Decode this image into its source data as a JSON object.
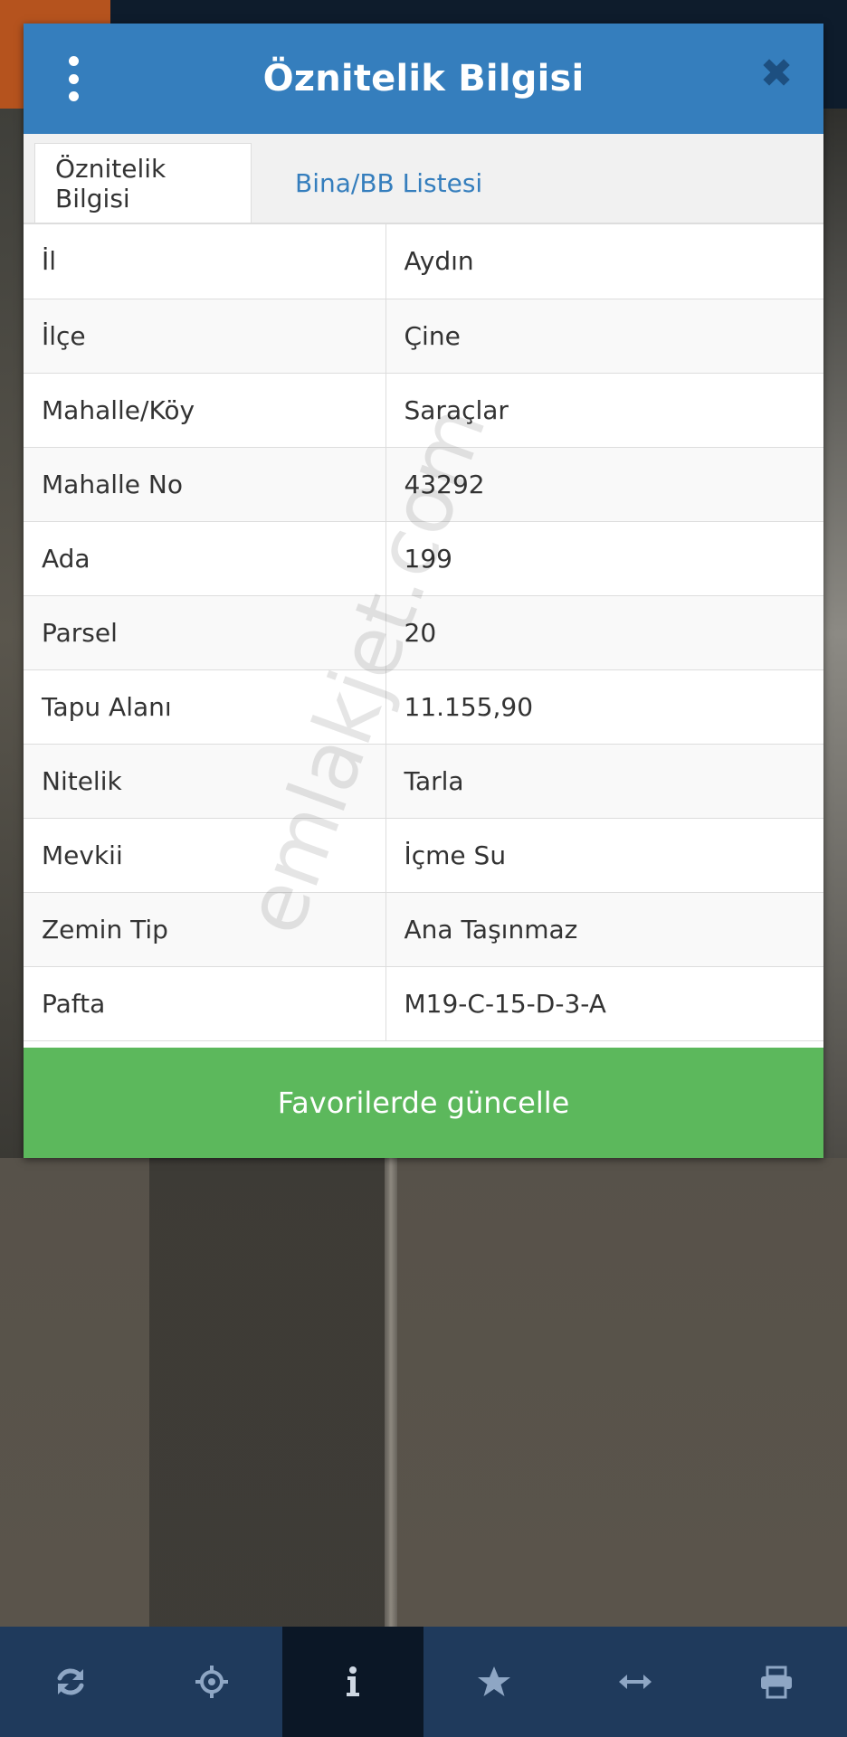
{
  "dialog": {
    "title": "Öznitelik Bilgisi",
    "close_label": "✖"
  },
  "tabs": [
    {
      "label": "Öznitelik Bilgisi",
      "active": true
    },
    {
      "label": "Bina/BB Listesi",
      "active": false
    }
  ],
  "attributes": [
    {
      "key": "İl",
      "value": "Aydın"
    },
    {
      "key": "İlçe",
      "value": "Çine"
    },
    {
      "key": "Mahalle/Köy",
      "value": "Saraçlar"
    },
    {
      "key": "Mahalle No",
      "value": "43292"
    },
    {
      "key": "Ada",
      "value": "199"
    },
    {
      "key": "Parsel",
      "value": "20"
    },
    {
      "key": "Tapu Alanı",
      "value": "11.155,90"
    },
    {
      "key": "Nitelik",
      "value": "Tarla"
    },
    {
      "key": "Mevkii",
      "value": "İçme Su"
    },
    {
      "key": "Zemin Tip",
      "value": "Ana Taşınmaz"
    },
    {
      "key": "Pafta",
      "value": "M19-C-15-D-3-A"
    }
  ],
  "favorite_button": {
    "label": "Favorilerde güncelle"
  },
  "watermark": "emlakjet.com",
  "toolbar": {
    "items": [
      {
        "icon": "refresh-icon"
      },
      {
        "icon": "crosshair-icon"
      },
      {
        "icon": "info-icon",
        "active": true
      },
      {
        "icon": "star-icon"
      },
      {
        "icon": "measure-arrows-icon"
      },
      {
        "icon": "print-icon"
      }
    ]
  },
  "colors": {
    "header": "#357ebd",
    "favorite_button": "#5cb85c",
    "toolbar": "#1f3a5c",
    "toolbar_active": "#0b1726"
  }
}
